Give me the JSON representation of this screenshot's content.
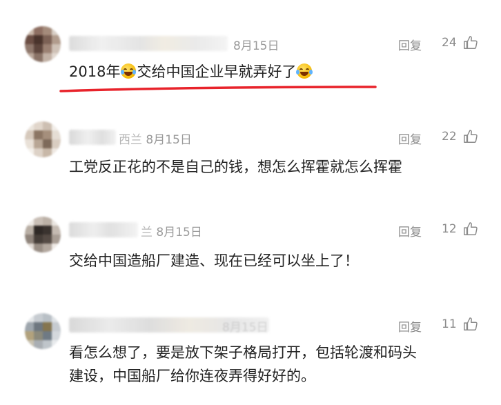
{
  "comments": [
    {
      "nick_fragment": "",
      "date": "8月15日",
      "reply_label": "回复",
      "like_count": "24",
      "text_lines": [
        "2018年",
        "交给中国企业早就弄好了"
      ]
    },
    {
      "nick_fragment": "西兰",
      "date": "8月15日",
      "reply_label": "回复",
      "like_count": "22",
      "text_lines": [
        "工党反正花的不是自己的钱，想怎么挥霍就怎么挥霍"
      ]
    },
    {
      "nick_fragment": "兰",
      "date": "8月15日",
      "reply_label": "回复",
      "like_count": "12",
      "text_lines": [
        "交给中国造船厂建造、现在已经可以坐上了！"
      ]
    },
    {
      "nick_fragment": "",
      "date": "8月15日",
      "reply_label": "回复",
      "like_count": "11",
      "text_lines": [
        "看怎么想了，要是放下架子格局打开，包括轮渡和码头",
        "建设，中国船厂给你连夜弄得好好的。"
      ]
    }
  ],
  "colors": {
    "highlight_underline": "#e8232b",
    "meta_text": "#9a9a9a",
    "body_text": "#222222"
  },
  "icons": {
    "like": "thumbs-up-outline-icon",
    "emoji_1": "crying-laughing-face-icon",
    "emoji_2": "laughing-face-icon"
  }
}
